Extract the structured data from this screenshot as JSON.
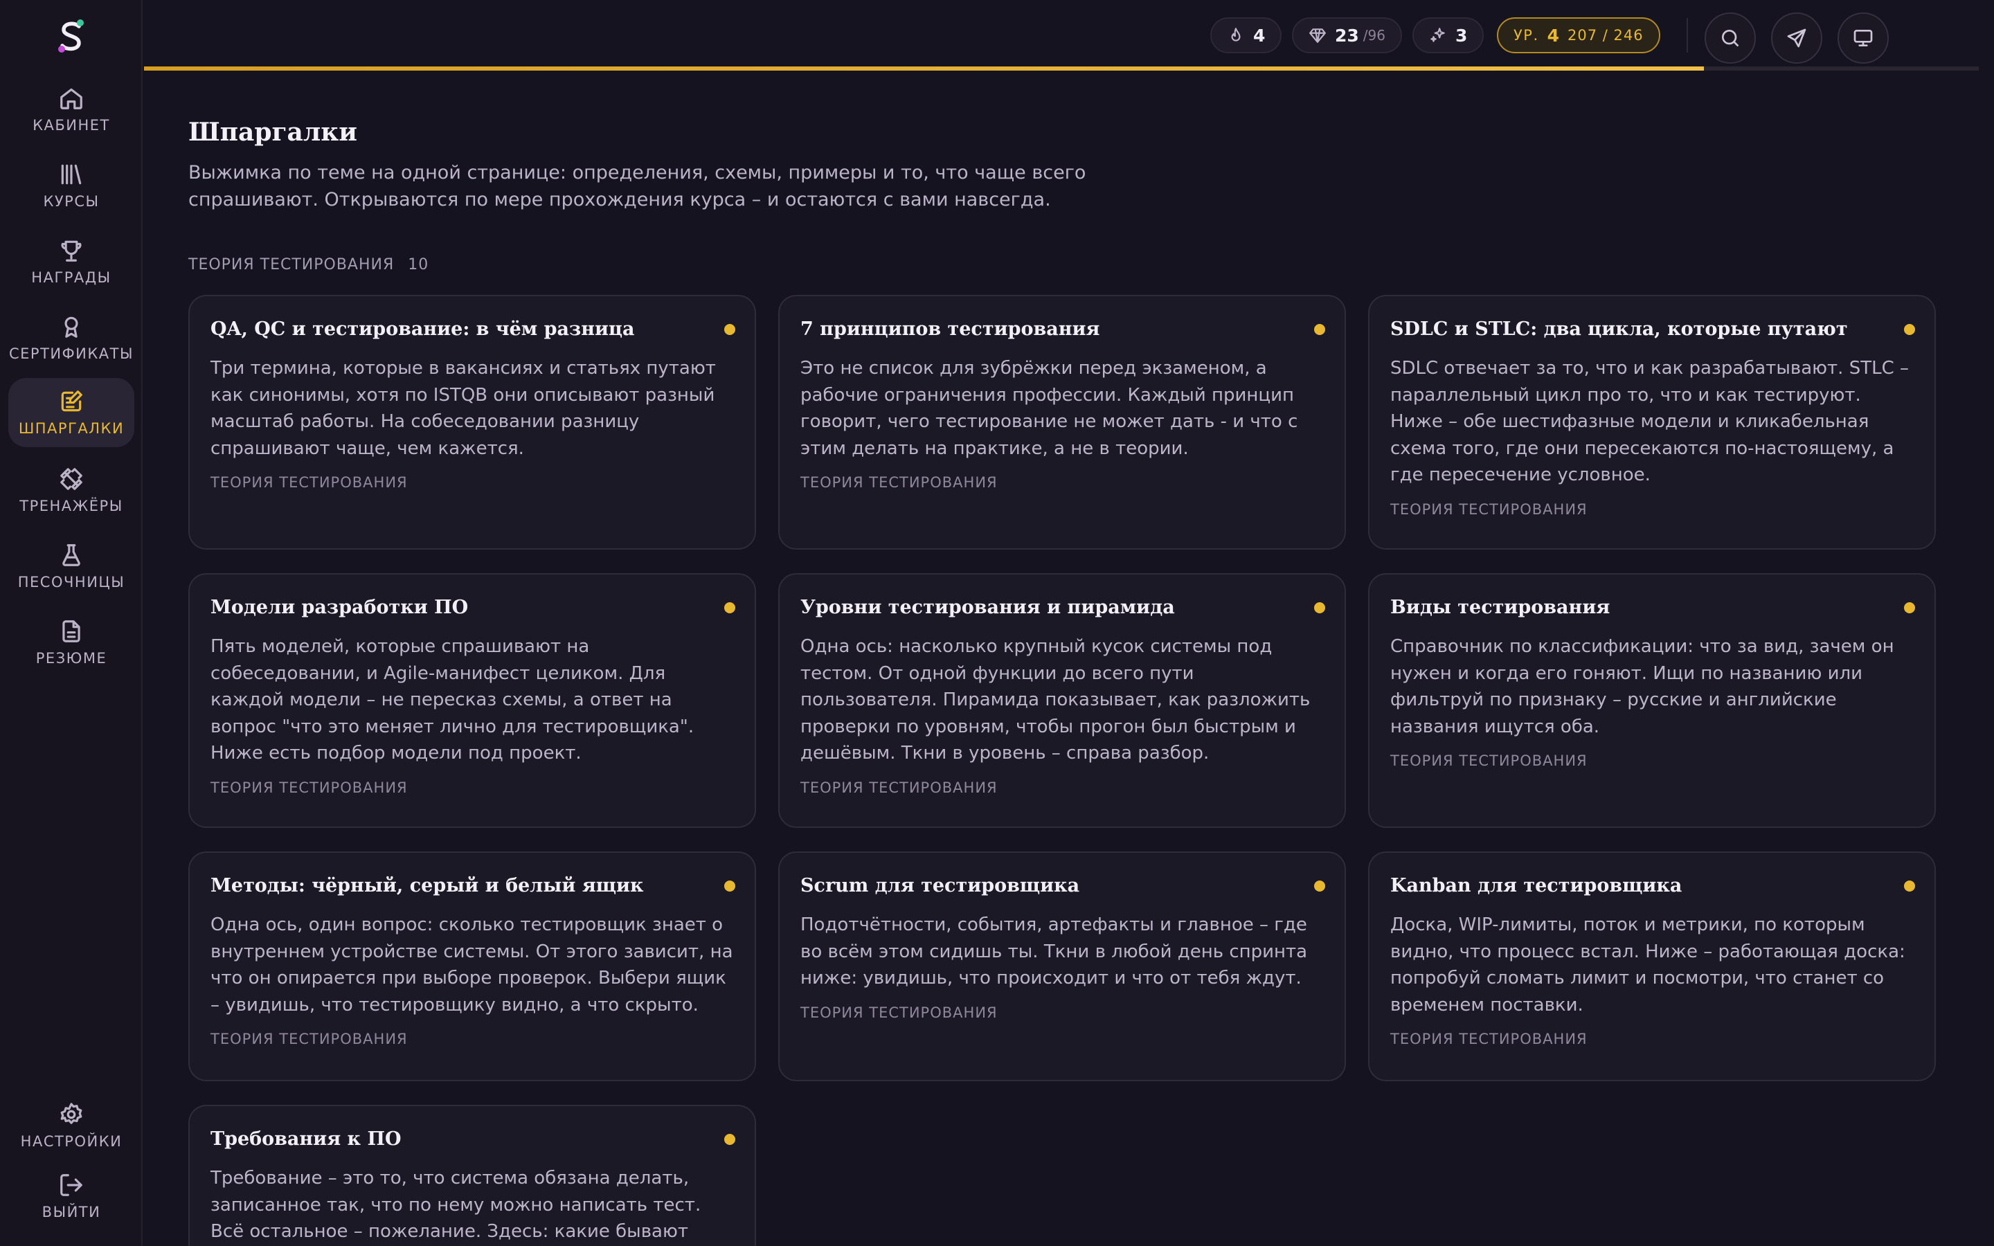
{
  "sidebar": {
    "items": [
      {
        "label": "КАБИНЕТ",
        "icon": "home-icon"
      },
      {
        "label": "КУРСЫ",
        "icon": "library-icon"
      },
      {
        "label": "НАГРАДЫ",
        "icon": "trophy-icon"
      },
      {
        "label": "СЕРТИФИКАТЫ",
        "icon": "award-icon"
      },
      {
        "label": "ШПАРГАЛКИ",
        "icon": "note-edit-icon",
        "active": true
      },
      {
        "label": "ТРЕНАЖЁРЫ",
        "icon": "dumbbell-icon"
      },
      {
        "label": "ПЕСОЧНИЦЫ",
        "icon": "flask-icon"
      },
      {
        "label": "РЕЗЮМЕ",
        "icon": "document-icon"
      }
    ],
    "settings_label": "НАСТРОЙКИ",
    "logout_label": "ВЫЙТИ"
  },
  "topbar": {
    "streak": "4",
    "gems": "23",
    "gems_total": "/96",
    "sparks": "3",
    "level_label": "УР.",
    "level": "4",
    "xp": "207 / 246",
    "xp_progress": 0.85
  },
  "colors": {
    "accent": "#e8b930",
    "background": "#161320",
    "card": "#1c1926"
  },
  "page": {
    "title": "Шпаргалки",
    "description": "Выжимка по теме на одной странице: определения, схемы, примеры и то, что чаще всего спрашивают. Открываются по мере прохождения курса – и остаются с вами навсегда."
  },
  "section": {
    "title": "ТЕОРИЯ ТЕСТИРОВАНИЯ",
    "count": "10"
  },
  "cards": [
    {
      "title": "QA, QC и тестирование: в чём разница",
      "text": "Три термина, которые в вакансиях и статьях путают как синонимы, хотя по ISTQB они описывают разный масштаб работы. На собеседовании разницу спрашивают чаще, чем кажется.",
      "tag": "ТЕОРИЯ ТЕСТИРОВАНИЯ"
    },
    {
      "title": "7 принципов тестирования",
      "text": "Это не список для зубрёжки перед экзаменом, а рабочие ограничения профессии. Каждый принцип говорит, чего тестирование не может дать - и что с этим делать на практике, а не в теории.",
      "tag": "ТЕОРИЯ ТЕСТИРОВАНИЯ"
    },
    {
      "title": "SDLC и STLC: два цикла, которые путают",
      "text": "SDLC отвечает за то, что и как разрабатывают. STLC – параллельный цикл про то, что и как тестируют. Ниже – обе шестифазные модели и кликабельная схема того, где они пересекаются по-настоящему, а где пересечение условное.",
      "tag": "ТЕОРИЯ ТЕСТИРОВАНИЯ"
    },
    {
      "title": "Модели разработки ПО",
      "text": "Пять моделей, которые спрашивают на собеседовании, и Agile-манифест целиком. Для каждой модели – не пересказ схемы, а ответ на вопрос \"что это меняет лично для тестировщика\". Ниже есть подбор модели под проект.",
      "tag": "ТЕОРИЯ ТЕСТИРОВАНИЯ"
    },
    {
      "title": "Уровни тестирования и пирамида",
      "text": "Одна ось: насколько крупный кусок системы под тестом. От одной функции до всего пути пользователя. Пирамида показывает, как разложить проверки по уровням, чтобы прогон был быстрым и дешёвым. Ткни в уровень – справа разбор.",
      "tag": "ТЕОРИЯ ТЕСТИРОВАНИЯ"
    },
    {
      "title": "Виды тестирования",
      "text": "Справочник по классификации: что за вид, зачем он нужен и когда его гоняют. Ищи по названию или фильтруй по признаку – русские и английские названия ищутся оба.",
      "tag": "ТЕОРИЯ ТЕСТИРОВАНИЯ"
    },
    {
      "title": "Методы: чёрный, серый и белый ящик",
      "text": "Одна ось, один вопрос: сколько тестировщик знает о внутреннем устройстве системы. От этого зависит, на что он опирается при выборе проверок. Выбери ящик – увидишь, что тестировщику видно, а что скрыто.",
      "tag": "ТЕОРИЯ ТЕСТИРОВАНИЯ"
    },
    {
      "title": "Scrum для тестировщика",
      "text": "Подотчётности, события, артефакты и главное – где во всём этом сидишь ты. Ткни в любой день спринта ниже: увидишь, что происходит и что от тебя ждут.",
      "tag": "ТЕОРИЯ ТЕСТИРОВАНИЯ"
    },
    {
      "title": "Kanban для тестировщика",
      "text": "Доска, WIP-лимиты, поток и метрики, по которым видно, что процесс встал. Ниже – работающая доска: попробуй сломать лимит и посмотри, что станет со временем поставки.",
      "tag": "ТЕОРИЯ ТЕСТИРОВАНИЯ"
    },
    {
      "title": "Требования к ПО",
      "text": "Требование – это то, что система обязана делать, записанное так, что по нему можно написать тест. Всё остальное – пожелание. Здесь: какие бывают",
      "tag": ""
    }
  ]
}
